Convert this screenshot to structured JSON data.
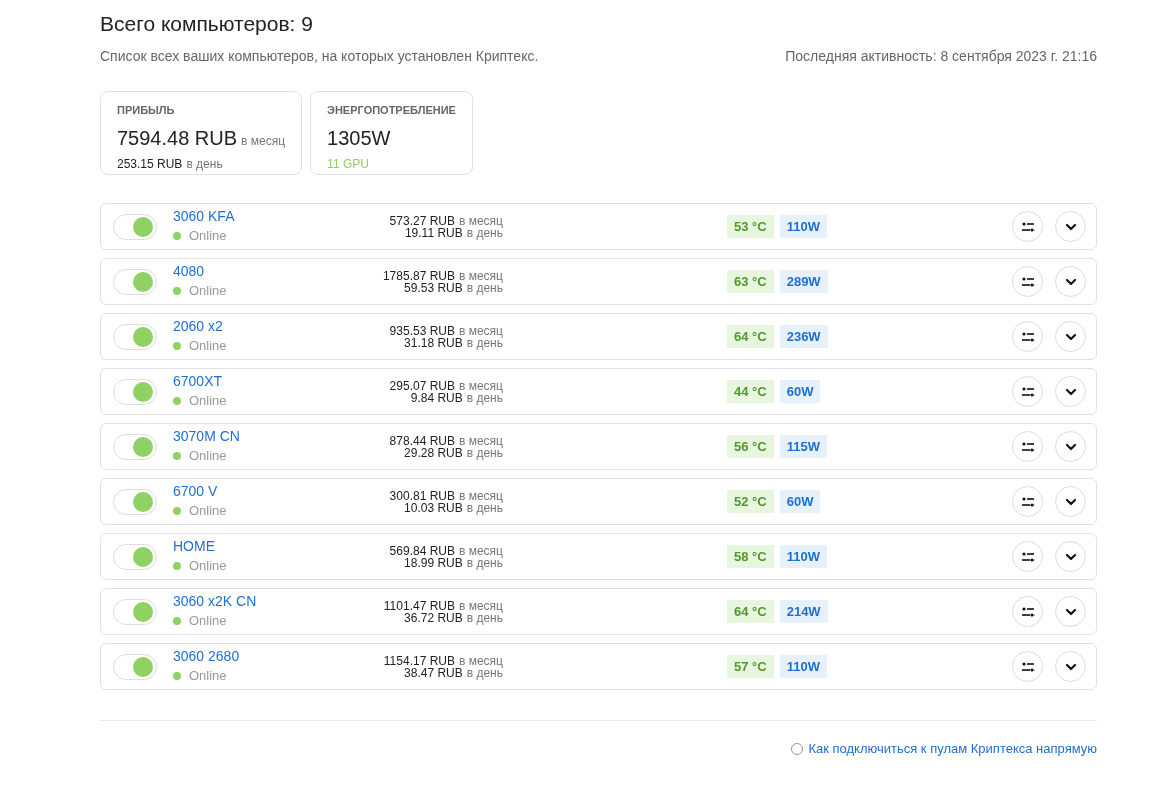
{
  "header": {
    "title": "Всего компьютеров: 9",
    "subtitle": "Список всех ваших компьютеров, на которых установлен Криптекс.",
    "last_activity": "Последняя активность: 8 сентября 2023 г. 21:16"
  },
  "stats": [
    {
      "label": "ПРИБЫЛЬ",
      "value": "7594.48 RUB",
      "value_suffix": "в месяц",
      "sub_value": "253.15 RUB",
      "sub_suffix": "в день"
    },
    {
      "label": "ЭНЕРГОПОТРЕБЛЕНИЕ",
      "value": "1305W",
      "sub_value": "11 GPU"
    }
  ],
  "computers": [
    {
      "name": "3060 KFA",
      "enabled": true,
      "status": "Online",
      "month": "573.27 RUB",
      "month_suffix": "в месяц",
      "day": "19.11 RUB",
      "day_suffix": "в день",
      "temp": "53 °C",
      "power": "110W"
    },
    {
      "name": "4080",
      "enabled": true,
      "status": "Online",
      "month": "1785.87 RUB",
      "month_suffix": "в месяц",
      "day": "59.53 RUB",
      "day_suffix": "в день",
      "temp": "63 °C",
      "power": "289W"
    },
    {
      "name": "2060 x2",
      "enabled": true,
      "status": "Online",
      "month": "935.53 RUB",
      "month_suffix": "в месяц",
      "day": "31.18 RUB",
      "day_suffix": "в день",
      "temp": "64 °C",
      "power": "236W"
    },
    {
      "name": "6700XT",
      "enabled": true,
      "status": "Online",
      "month": "295.07 RUB",
      "month_suffix": "в месяц",
      "day": "9.84 RUB",
      "day_suffix": "в день",
      "temp": "44 °C",
      "power": "60W"
    },
    {
      "name": "3070M CN",
      "enabled": true,
      "status": "Online",
      "month": "878.44 RUB",
      "month_suffix": "в месяц",
      "day": "29.28 RUB",
      "day_suffix": "в день",
      "temp": "56 °C",
      "power": "115W"
    },
    {
      "name": "6700 V",
      "enabled": true,
      "status": "Online",
      "month": "300.81 RUB",
      "month_suffix": "в месяц",
      "day": "10.03 RUB",
      "day_suffix": "в день",
      "temp": "52 °C",
      "power": "60W"
    },
    {
      "name": "HOME",
      "enabled": true,
      "status": "Online",
      "month": "569.84 RUB",
      "month_suffix": "в месяц",
      "day": "18.99 RUB",
      "day_suffix": "в день",
      "temp": "58 °C",
      "power": "110W"
    },
    {
      "name": "3060 x2K CN",
      "enabled": true,
      "status": "Online",
      "month": "1101.47 RUB",
      "month_suffix": "в месяц",
      "day": "36.72 RUB",
      "day_suffix": "в день",
      "temp": "64 °C",
      "power": "214W"
    },
    {
      "name": "3060 2680",
      "enabled": true,
      "status": "Online",
      "month": "1154.17 RUB",
      "month_suffix": "в месяц",
      "day": "38.47 RUB",
      "day_suffix": "в день",
      "temp": "57 °C",
      "power": "110W"
    }
  ],
  "help_link": "Как подключиться к пулам Криптекса напрямую"
}
